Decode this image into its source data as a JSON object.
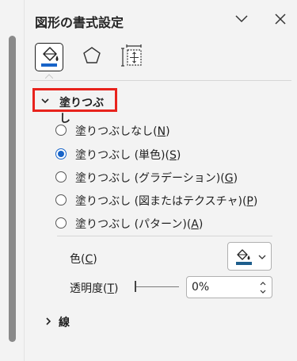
{
  "pane": {
    "title": "図形の書式設定",
    "minimize_icon": "chevron-down-icon",
    "close_icon": "close-icon"
  },
  "tabs": [
    {
      "name": "fill-and-line",
      "icon": "paint-bucket-icon",
      "active": true
    },
    {
      "name": "effects",
      "icon": "pentagon-icon",
      "active": false
    },
    {
      "name": "size-and-properties",
      "icon": "size-properties-icon",
      "active": false
    }
  ],
  "fill_section": {
    "label": "塗りつぶし",
    "expanded": true,
    "highlight_color": "#e8231d",
    "options": [
      {
        "text": "塗りつぶしなし(",
        "key": "N",
        "tail": ")",
        "checked": false
      },
      {
        "text": "塗りつぶし (単色)(",
        "key": "S",
        "tail": ")",
        "checked": true
      },
      {
        "text": "塗りつぶし (グラデーション)(",
        "key": "G",
        "tail": ")",
        "checked": false
      },
      {
        "text": "塗りつぶし (図またはテクスチャ)(",
        "key": "P",
        "tail": ")",
        "checked": false
      },
      {
        "text": "塗りつぶし (パターン)(",
        "key": "A",
        "tail": ")",
        "checked": false
      }
    ],
    "color": {
      "label": "色(",
      "key": "C",
      "tail": ")",
      "swatch": "#1e5e8c"
    },
    "transparency": {
      "label": "透明度(",
      "key": "T",
      "tail": ")",
      "value": "0%",
      "level": 0
    }
  },
  "line_section": {
    "label": "線",
    "expanded": false
  },
  "accent_color": "#1864c8"
}
